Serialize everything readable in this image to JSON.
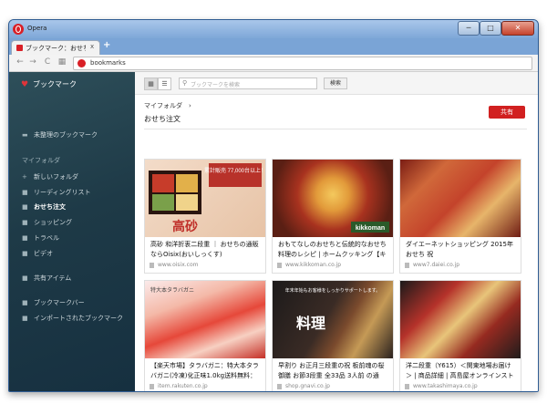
{
  "window": {
    "app_title": "Opera",
    "minimize": "─",
    "maximize": "□",
    "close": "✕"
  },
  "tab": {
    "label": "ブックマーク：おせち注",
    "close": "x",
    "new": "+"
  },
  "toolbar": {
    "back": "←",
    "forward": "→",
    "reload": "C",
    "grid": "▦",
    "address": "bookmarks"
  },
  "sidebar": {
    "header": "ブックマーク",
    "items": [
      {
        "label": "未整理のブックマーク",
        "icon": "bookmark-icon"
      },
      {
        "label": "マイフォルダ",
        "section": true
      },
      {
        "label": "新しいフォルダ",
        "icon": "plus-icon"
      },
      {
        "label": "リーディングリスト",
        "icon": "folder-icon"
      },
      {
        "label": "おせち注文",
        "icon": "folder-icon",
        "active": true
      },
      {
        "label": "ショッピング",
        "icon": "folder-icon"
      },
      {
        "label": "トラベル",
        "icon": "folder-icon"
      },
      {
        "label": "ビデオ",
        "icon": "folder-icon"
      },
      {
        "label": "共有アイテム",
        "icon": "folder-icon"
      },
      {
        "label": "ブックマークバー",
        "icon": "folder-icon"
      },
      {
        "label": "インポートされたブックマーク",
        "icon": "folder-icon"
      }
    ]
  },
  "main": {
    "search_placeholder": "ブックマークを検索",
    "search_button": "検索",
    "breadcrumb": "マイフォルダ　›",
    "title": "おせち注文",
    "share_button": "共有",
    "thumb_texts": {
      "t1_text": "累計販売\n77,000台以上！",
      "t1_brand": "高砂",
      "t2_brand": "kikkoman",
      "t4_text": "特大本タラバガニ",
      "t5_text": "年末年始もお客様をしっかりサポートします。",
      "t5_brand": "料理"
    },
    "cards": [
      {
        "title": "高砂 和洋折衷二段重 ｜ おせちの通販ならOisix(おいしっくす)",
        "url": "www.oisix.com"
      },
      {
        "title": "おもてなしのおせちと伝統的なおせち料理のレシピ | ホームクッキング【キッコ...",
        "url": "www.kikkoman.co.jp"
      },
      {
        "title": "ダイエーネットショッピング 2015年おせち 祝",
        "url": "www7.daiei.co.jp"
      },
      {
        "title": "【楽天市場】タラバガニ：特大本タラバガニ(冷凍)化正味1.0kg送料無料：島の...",
        "url": "item.rakuten.co.jp"
      },
      {
        "title": "早割り お正月三段重の祝 板前魂の桜御膳 お節3段重 全33品 3人前 の通販...",
        "url": "shop.gnavi.co.jp"
      },
      {
        "title": "洋二段重（Y615）＜関東地場お届け＞ | 商品詳細 | 高島屋オンラインストア",
        "url": "www.takashimaya.co.jp"
      }
    ]
  }
}
